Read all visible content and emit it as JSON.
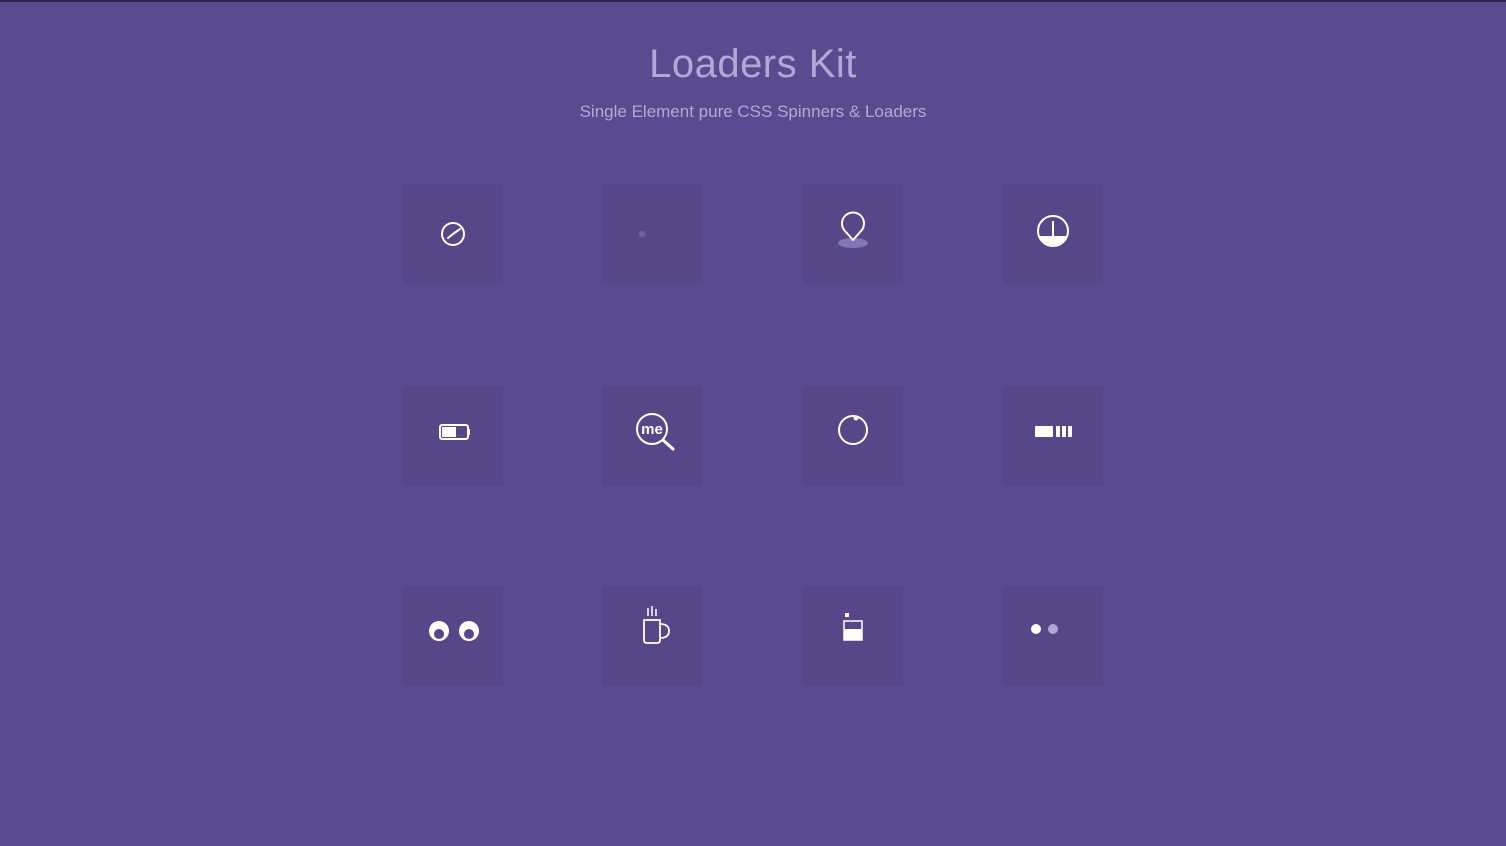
{
  "header": {
    "title": "Loaders Kit",
    "subtitle": "Single Element pure CSS Spinners & Loaders"
  },
  "colors": {
    "background": "#5a4a8f",
    "tile": "#574788",
    "text": "#b2a8d4",
    "icon": "#ffffff"
  },
  "loaders": [
    {
      "icon": "clock-icon"
    },
    {
      "icon": "dot-icon"
    },
    {
      "icon": "map-pin-icon"
    },
    {
      "icon": "gauge-icon"
    },
    {
      "icon": "battery-icon"
    },
    {
      "icon": "me-search-icon",
      "text": "me"
    },
    {
      "icon": "orbit-circle-icon"
    },
    {
      "icon": "progress-bars-icon"
    },
    {
      "icon": "eyes-icon"
    },
    {
      "icon": "coffee-cup-icon"
    },
    {
      "icon": "glass-fill-icon"
    },
    {
      "icon": "two-dots-icon"
    }
  ]
}
